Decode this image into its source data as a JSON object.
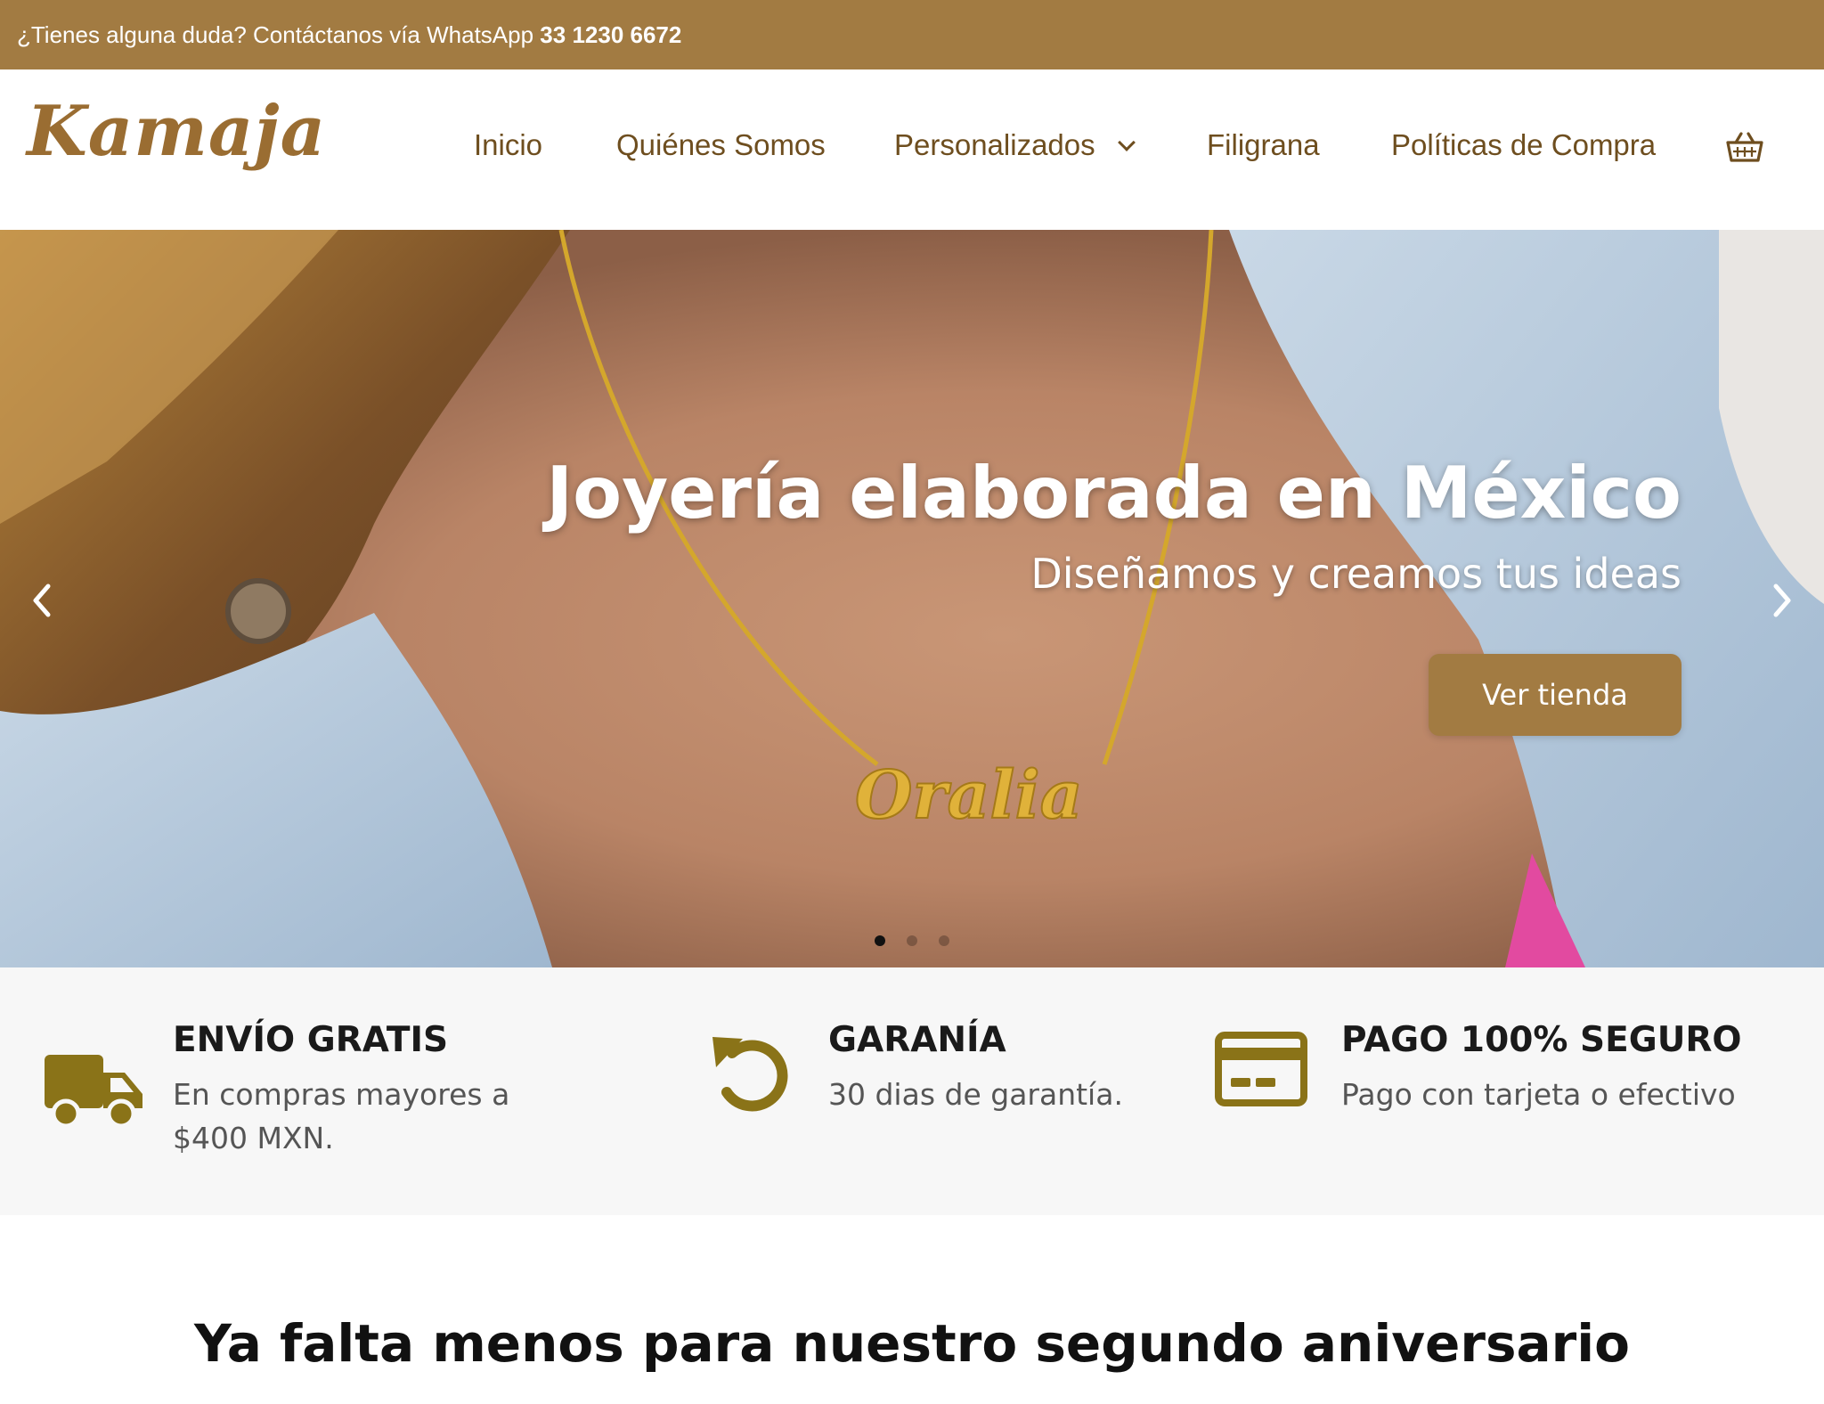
{
  "topbar": {
    "message": "¿Tienes alguna duda? Contáctanos vía WhatsApp ",
    "phone": "33 1230 6672"
  },
  "header": {
    "logo": "Kamaja",
    "nav": [
      {
        "label": "Inicio"
      },
      {
        "label": "Quiénes Somos"
      },
      {
        "label": "Personalizados",
        "has_dropdown": true
      },
      {
        "label": "Filigrana"
      },
      {
        "label": "Políticas de Compra"
      }
    ],
    "cart_icon": "basket-icon"
  },
  "hero": {
    "title": "Joyería elaborada en México",
    "subtitle": "Diseñamos y creamos tus ideas",
    "button_label": "Ver tienda",
    "pendant_text": "Oralia",
    "slides_total": 3,
    "active_slide": 1
  },
  "features": [
    {
      "icon": "truck-icon",
      "title": "ENVÍO GRATIS",
      "text": "En compras mayores a $400 MXN."
    },
    {
      "icon": "undo-icon",
      "title": "GARANÍA",
      "text": "30 dias de garantía."
    },
    {
      "icon": "credit-card-icon",
      "title": "PAGO 100% SEGURO",
      "text": "Pago con tarjeta o efectivo"
    }
  ],
  "section": {
    "title": "Ya falta menos para nuestro segundo aniversario"
  },
  "colors": {
    "brand": "#a27b42",
    "nav_text": "#6e4e1f",
    "icon": "#8a7318",
    "features_bg": "#f7f7f7"
  }
}
